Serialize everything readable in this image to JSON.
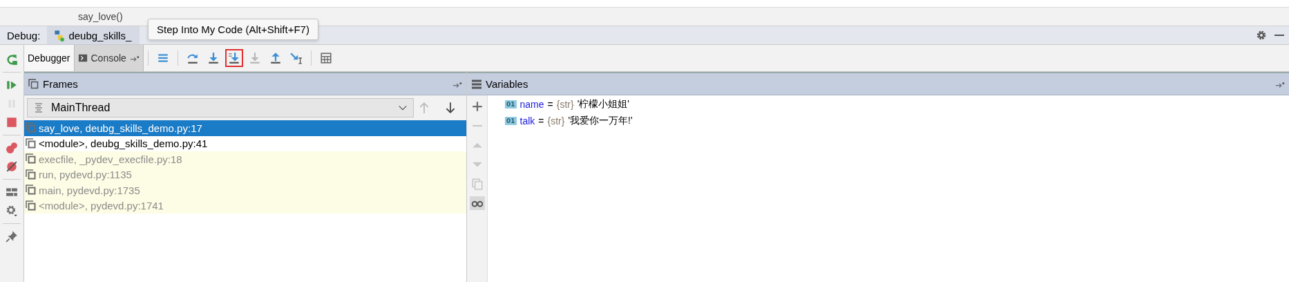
{
  "editor": {
    "code_line": "say_love()"
  },
  "debug_bar": {
    "label": "Debug:",
    "session_tab": "deubg_skills_"
  },
  "tooltip": {
    "text": "Step Into My Code (Alt+Shift+F7)"
  },
  "side_tools": [
    {
      "kind": "rerun",
      "disabled": false
    },
    {
      "kind": "resume",
      "disabled": false
    },
    {
      "kind": "pause",
      "disabled": true
    },
    {
      "kind": "stop",
      "disabled": false
    },
    {
      "kind": "breakpoints",
      "disabled": false
    },
    {
      "kind": "mute",
      "disabled": false
    },
    {
      "kind": "layout",
      "disabled": false
    },
    {
      "kind": "settings",
      "disabled": false
    },
    {
      "kind": "pin",
      "disabled": false
    }
  ],
  "tabs": [
    {
      "label": "Debugger",
      "selected": true
    },
    {
      "label": "Console",
      "selected": false
    }
  ],
  "toolbar": [
    {
      "kind": "show-execution-point",
      "disabled": false,
      "highlighted": false
    },
    {
      "kind": "step-over",
      "disabled": false,
      "highlighted": false
    },
    {
      "kind": "step-into",
      "disabled": false,
      "highlighted": false
    },
    {
      "kind": "step-into-my-code",
      "disabled": false,
      "highlighted": true
    },
    {
      "kind": "force-step-into",
      "disabled": true,
      "highlighted": false
    },
    {
      "kind": "step-out",
      "disabled": false,
      "highlighted": false
    },
    {
      "kind": "run-to-cursor",
      "disabled": false,
      "highlighted": false
    },
    {
      "kind": "evaluate",
      "disabled": false,
      "highlighted": false
    }
  ],
  "frames": {
    "title": "Frames",
    "thread": "MainThread",
    "items": [
      {
        "text": "say_love, deubg_skills_demo.py:17",
        "selected": true,
        "library": false
      },
      {
        "text": "<module>, deubg_skills_demo.py:41",
        "selected": false,
        "library": false
      },
      {
        "text": "execfile, _pydev_execfile.py:18",
        "selected": false,
        "library": true
      },
      {
        "text": "run, pydevd.py:1135",
        "selected": false,
        "library": true
      },
      {
        "text": "main, pydevd.py:1735",
        "selected": false,
        "library": true
      },
      {
        "text": "<module>, pydevd.py:1741",
        "selected": false,
        "library": true
      }
    ]
  },
  "variable_tools": [
    {
      "kind": "add",
      "disabled": false,
      "selected": false
    },
    {
      "kind": "remove",
      "disabled": true,
      "selected": false
    },
    {
      "kind": "move-up",
      "disabled": true,
      "selected": false
    },
    {
      "kind": "move-down",
      "disabled": true,
      "selected": false
    },
    {
      "kind": "copy",
      "disabled": true,
      "selected": false
    },
    {
      "kind": "watches",
      "disabled": false,
      "selected": true
    }
  ],
  "variables": {
    "title": "Variables",
    "items": [
      {
        "badge": "01",
        "name": "name",
        "operator": "=",
        "type": "{str}",
        "value": "'柠檬小姐姐'"
      },
      {
        "badge": "01",
        "name": "talk",
        "operator": "=",
        "type": "{str}",
        "value": "'我爱你一万年!'"
      }
    ]
  }
}
